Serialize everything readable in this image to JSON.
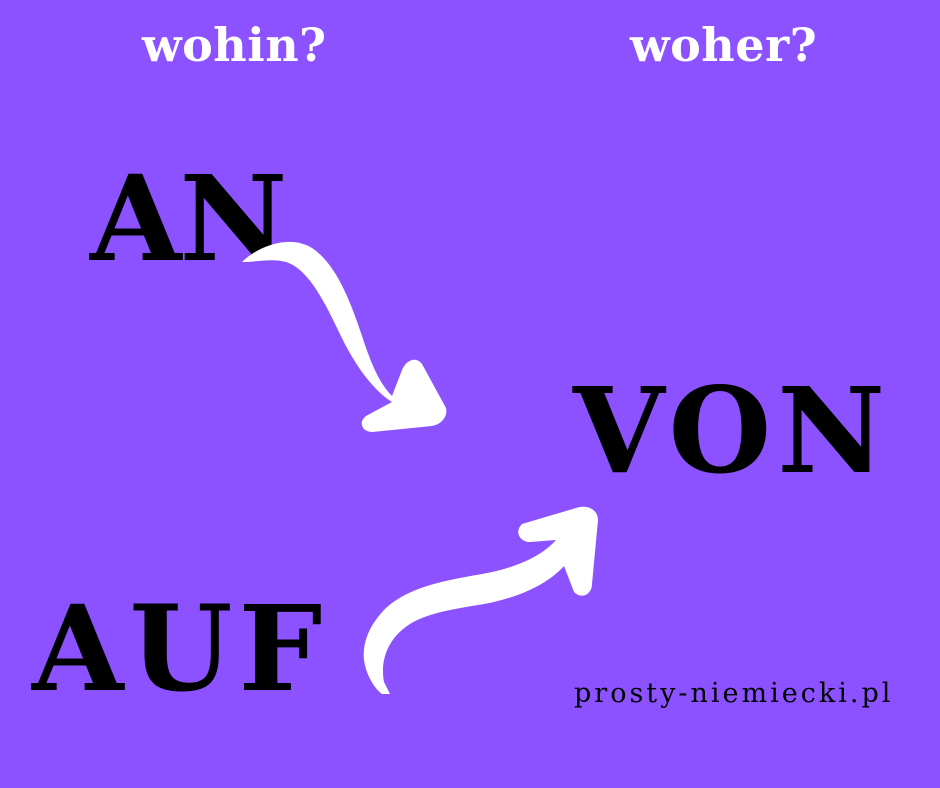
{
  "headings": {
    "left": "wohin?",
    "right": "woher?"
  },
  "words": {
    "an": "AN",
    "von": "VON",
    "auf": "AUF"
  },
  "website": "prosty-niemiecki.pl",
  "colors": {
    "background": "#8c52ff",
    "text_dark": "#000000",
    "text_light": "#ffffff",
    "arrow": "#ffffff"
  },
  "icons": {
    "arrow_top": "curved-arrow-down-right-icon",
    "arrow_bottom": "curved-arrow-up-right-icon"
  }
}
